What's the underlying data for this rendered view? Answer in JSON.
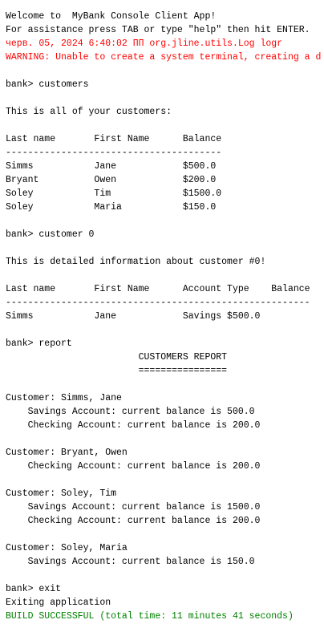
{
  "console": {
    "colors": {
      "default": "#000000",
      "error": "#ff0000",
      "success": "#008000",
      "background": "#ffffff"
    },
    "lines": [
      {
        "text": "Welcome to  MyBank Console Client App!",
        "style": "normal"
      },
      {
        "text": "For assistance press TAB or type \"help\" then hit ENTER.",
        "style": "normal"
      },
      {
        "text": "черв. 05, 2024 6:40:02 ПП org.jline.utils.Log logr",
        "style": "red"
      },
      {
        "text": "WARNING: Unable to create a system terminal, creating a d",
        "style": "red"
      },
      {
        "text": "",
        "style": "normal"
      },
      {
        "text": "bank> customers",
        "style": "normal"
      },
      {
        "text": "",
        "style": "normal"
      },
      {
        "text": "This is all of your customers:",
        "style": "normal"
      },
      {
        "text": "",
        "style": "normal"
      },
      {
        "text": "Last name       First Name      Balance",
        "style": "normal"
      },
      {
        "text": "---------------------------------------",
        "style": "normal"
      },
      {
        "text": "Simms           Jane            $500.0",
        "style": "normal"
      },
      {
        "text": "Bryant          Owen            $200.0",
        "style": "normal"
      },
      {
        "text": "Soley           Tim             $1500.0",
        "style": "normal"
      },
      {
        "text": "Soley           Maria           $150.0",
        "style": "normal"
      },
      {
        "text": "",
        "style": "normal"
      },
      {
        "text": "bank> customer 0",
        "style": "normal"
      },
      {
        "text": "",
        "style": "normal"
      },
      {
        "text": "This is detailed information about customer #0!",
        "style": "normal"
      },
      {
        "text": "",
        "style": "normal"
      },
      {
        "text": "Last name       First Name      Account Type    Balance",
        "style": "normal"
      },
      {
        "text": "-------------------------------------------------------",
        "style": "normal"
      },
      {
        "text": "Simms           Jane            Savings $500.0",
        "style": "normal"
      },
      {
        "text": "",
        "style": "normal"
      },
      {
        "text": "bank> report",
        "style": "normal"
      },
      {
        "text": "                        CUSTOMERS REPORT",
        "style": "normal"
      },
      {
        "text": "                        ================",
        "style": "normal"
      },
      {
        "text": "",
        "style": "normal"
      },
      {
        "text": "Customer: Simms, Jane",
        "style": "normal"
      },
      {
        "text": "    Savings Account: current balance is 500.0",
        "style": "normal"
      },
      {
        "text": "    Checking Account: current balance is 200.0",
        "style": "normal"
      },
      {
        "text": "",
        "style": "normal"
      },
      {
        "text": "Customer: Bryant, Owen",
        "style": "normal"
      },
      {
        "text": "    Checking Account: current balance is 200.0",
        "style": "normal"
      },
      {
        "text": "",
        "style": "normal"
      },
      {
        "text": "Customer: Soley, Tim",
        "style": "normal"
      },
      {
        "text": "    Savings Account: current balance is 1500.0",
        "style": "normal"
      },
      {
        "text": "    Checking Account: current balance is 200.0",
        "style": "normal"
      },
      {
        "text": "",
        "style": "normal"
      },
      {
        "text": "Customer: Soley, Maria",
        "style": "normal"
      },
      {
        "text": "    Savings Account: current balance is 150.0",
        "style": "normal"
      },
      {
        "text": "",
        "style": "normal"
      },
      {
        "text": "bank> exit",
        "style": "normal"
      },
      {
        "text": "Exiting application",
        "style": "normal"
      },
      {
        "text": "BUILD SUCCESSFUL (total time: 11 minutes 41 seconds)",
        "style": "green"
      }
    ]
  }
}
